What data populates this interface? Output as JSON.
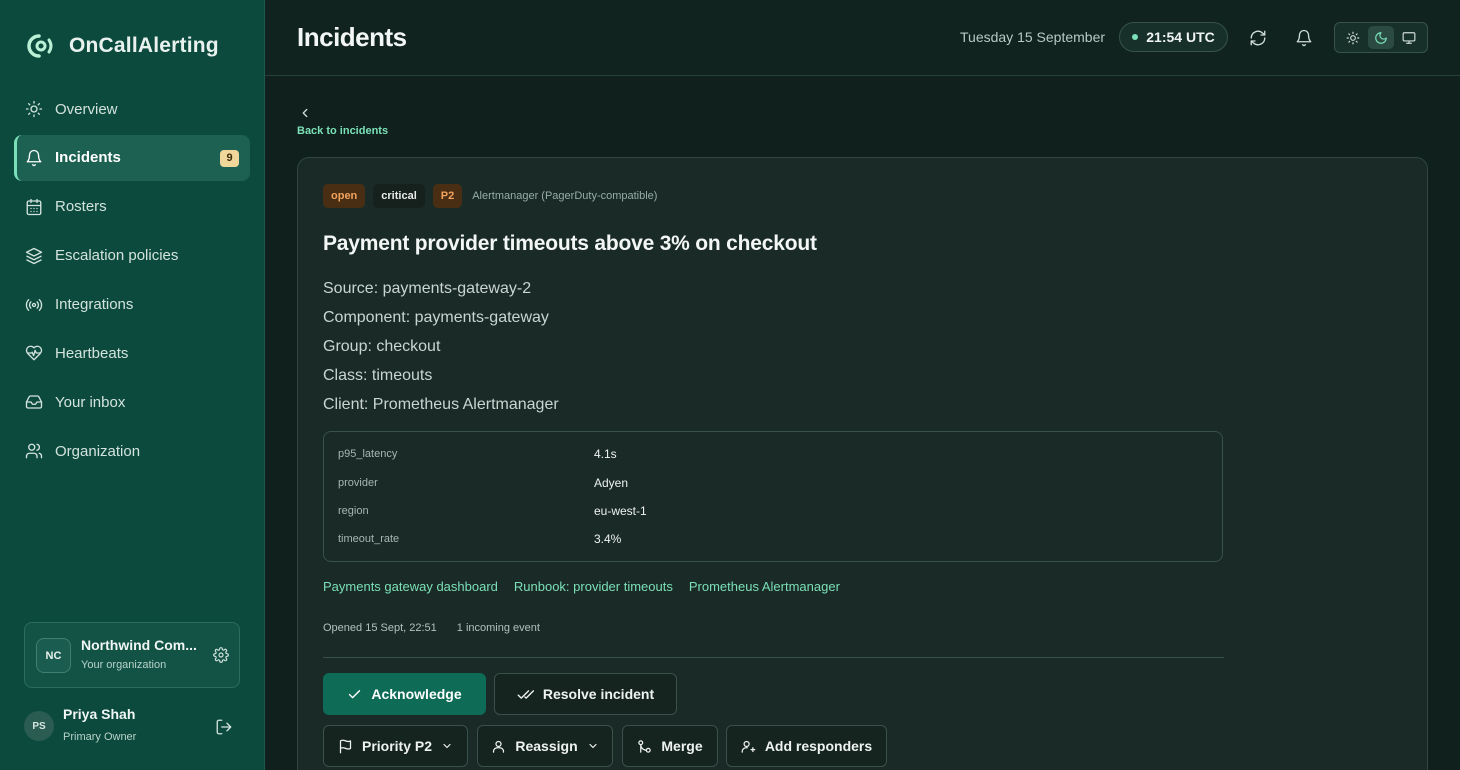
{
  "brand": {
    "name": "OnCallAlerting",
    "icon": "oncall-logo-icon"
  },
  "nav": [
    {
      "label": "Overview",
      "icon": "sun-icon"
    },
    {
      "label": "Incidents",
      "icon": "bell-icon",
      "badge": "9",
      "active": true
    },
    {
      "label": "Rosters",
      "icon": "calendar-icon"
    },
    {
      "label": "Escalation policies",
      "icon": "layers-icon"
    },
    {
      "label": "Integrations",
      "icon": "radio-icon"
    },
    {
      "label": "Heartbeats",
      "icon": "heart-pulse-icon"
    },
    {
      "label": "Your inbox",
      "icon": "inbox-icon"
    },
    {
      "label": "Organization",
      "icon": "users-icon"
    }
  ],
  "org": {
    "initials": "NC",
    "name": "Northwind Com...",
    "subtitle": "Your organization"
  },
  "user": {
    "initials": "PS",
    "name": "Priya Shah",
    "role": "Primary Owner"
  },
  "header": {
    "title": "Incidents",
    "date": "Tuesday 15 September",
    "time": "21:54 UTC"
  },
  "back": {
    "label": "Back to incidents"
  },
  "incident": {
    "status": "open",
    "severity": "critical",
    "priority": "P2",
    "source_label": "Alertmanager (PagerDuty-compatible)",
    "title": "Payment provider timeouts above 3% on checkout",
    "meta": [
      "Source: payments-gateway-2",
      "Component: payments-gateway",
      "Group: checkout",
      "Class: timeouts",
      "Client: Prometheus Alertmanager"
    ],
    "details": [
      {
        "key": "p95_latency",
        "value": "4.1s"
      },
      {
        "key": "provider",
        "value": "Adyen"
      },
      {
        "key": "region",
        "value": "eu-west-1"
      },
      {
        "key": "timeout_rate",
        "value": "3.4%"
      }
    ],
    "links": [
      "Payments gateway dashboard",
      "Runbook: provider timeouts",
      "Prometheus Alertmanager"
    ],
    "opened": "Opened 15 Sept, 22:51",
    "events": "1 incoming event"
  },
  "actions": {
    "acknowledge": "Acknowledge",
    "resolve": "Resolve incident",
    "priority": "Priority P2",
    "reassign": "Reassign",
    "merge": "Merge",
    "add_responders": "Add responders"
  },
  "colors": {
    "accent": "#7be0b8",
    "sidebar": "#0c4a3e",
    "primary_button": "#0d6b56",
    "warning": "#f0a35d"
  }
}
